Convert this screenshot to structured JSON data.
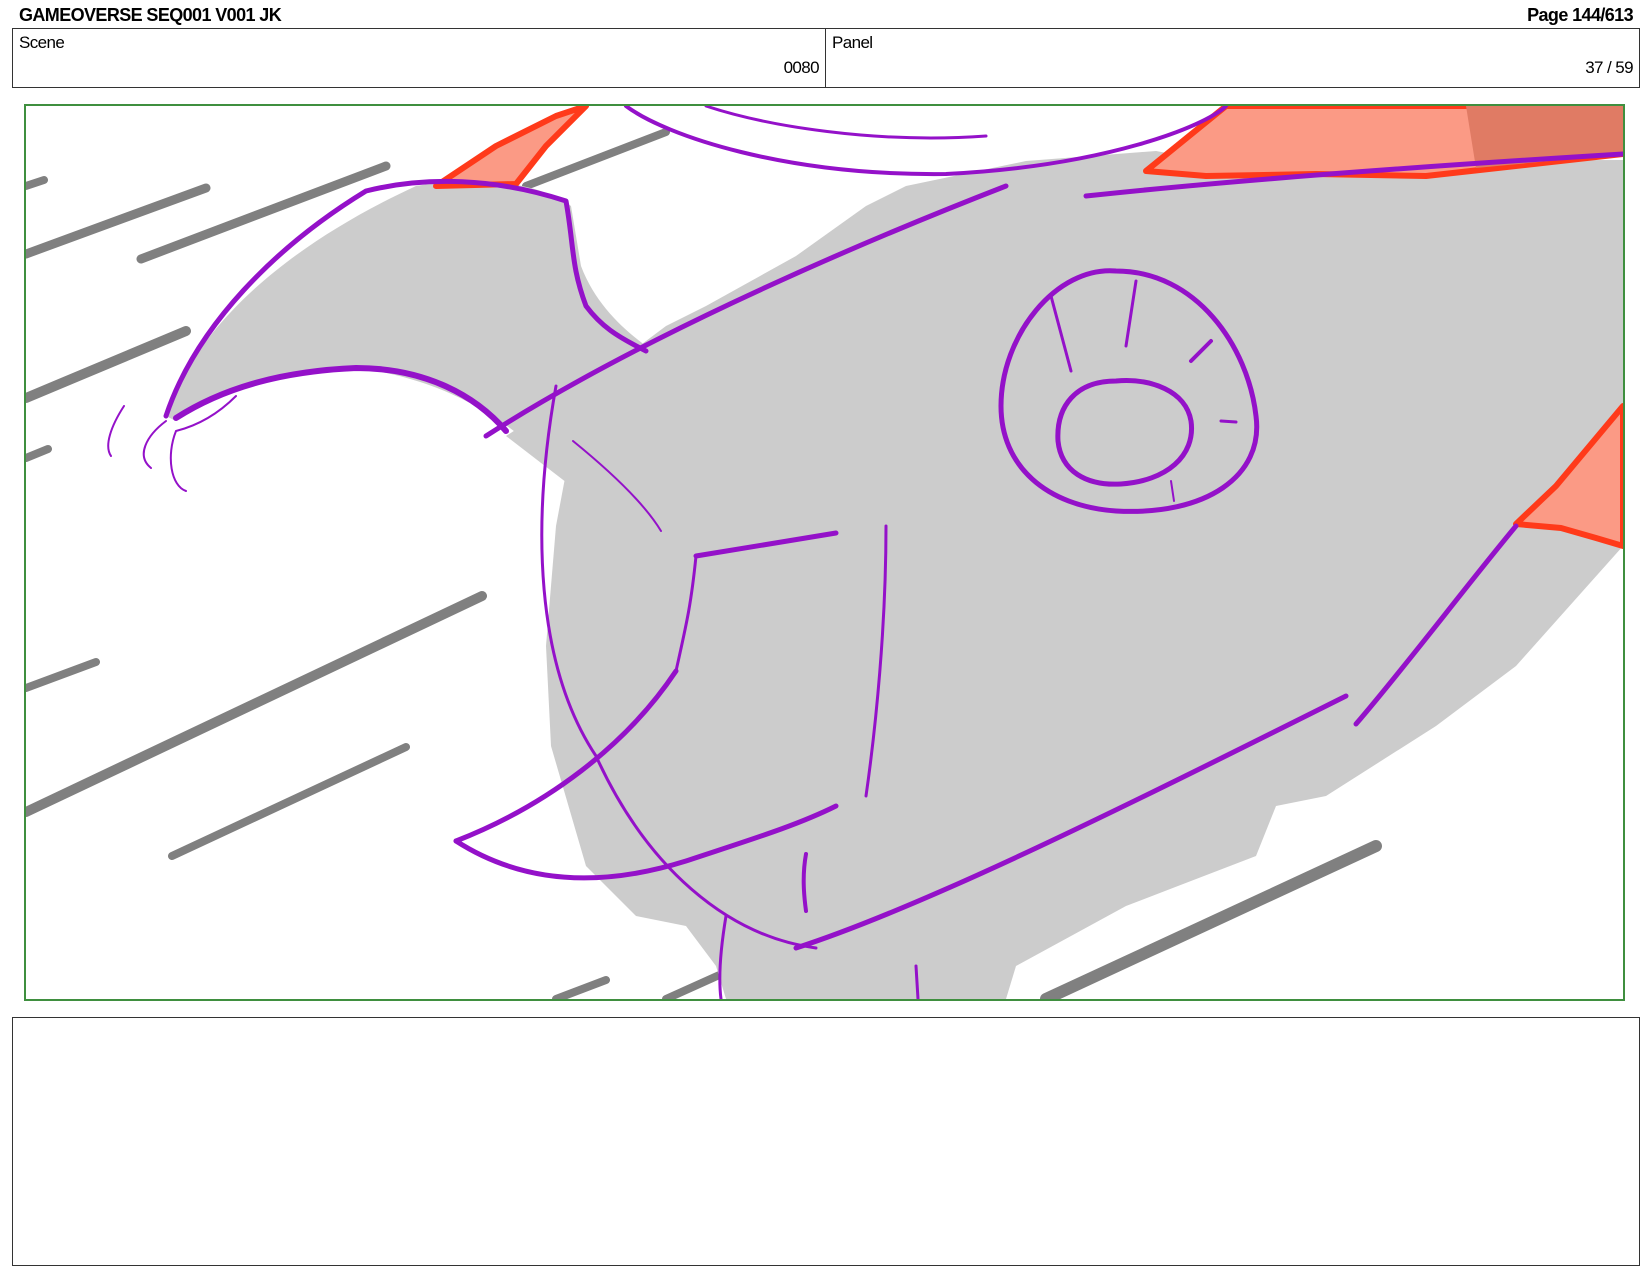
{
  "header": {
    "title": "GAMEOVERSE SEQ001 V001 JK",
    "page": "Page 144/613"
  },
  "scene": {
    "label": "Scene",
    "value": "0080"
  },
  "panel": {
    "label": "Panel",
    "value": "37 / 59"
  },
  "artwork": {
    "outline_color": "#9411c9",
    "fill_color": "#cccccc",
    "speed_line_color": "#808080",
    "accent_color": "#ff3a1a",
    "accent_fill": "#fb9a85",
    "frame_color": "#3f8f3f"
  },
  "notes": {
    "text": ""
  }
}
